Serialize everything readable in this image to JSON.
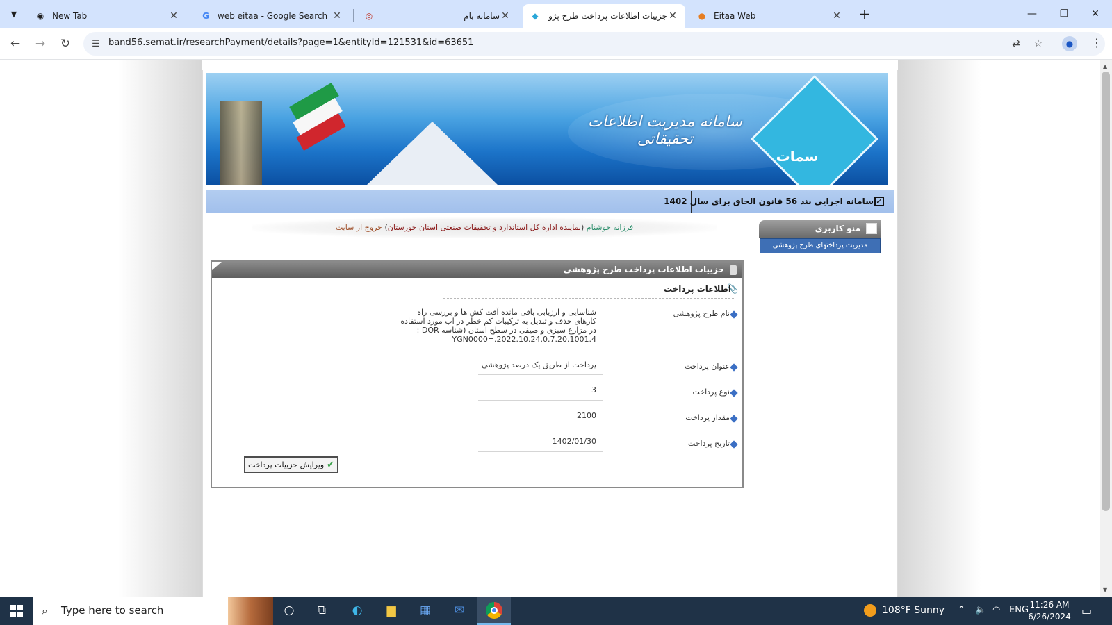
{
  "browser": {
    "tabs": [
      {
        "title": "New Tab",
        "icon": "chrome-icon"
      },
      {
        "title": "web eitaa - Google Search",
        "icon": "google-icon"
      },
      {
        "title": "سامانه بام",
        "icon": "bam-icon"
      },
      {
        "title": "جزییات اطلاعات پرداخت طرح پژو",
        "icon": "semat-icon",
        "active": true
      },
      {
        "title": "Eitaa Web",
        "icon": "eitaa-icon"
      }
    ],
    "url": "band56.semat.ir/researchPayment/details?page=1&entityId=121531&id=63651"
  },
  "page": {
    "banner": {
      "logo_text": "سمات",
      "title_text": "سامانه مدیریت اطلاعات تحقیقاتی"
    },
    "system_title": "سامانه اجرایی بند 56 قانون الحاق برای سال 1402",
    "user": {
      "name": "فرزانه خوشنام",
      "org_open": "(",
      "org": "نماینده اداره کل استاندارد و تحقیقات صنعتی استان خوزستان",
      "org_close": ")",
      "logout": "خروج از سایت"
    },
    "user_menu": {
      "title": "منو کاربری",
      "items": [
        "مدیریت پرداختهای طرح پژوهشی"
      ]
    },
    "panel": {
      "title": "جزییات اطلاعات پرداخت طرح پژوهشی",
      "section_title": "اطلاعات پرداخت",
      "rows": [
        {
          "label": "نام طرح پژوهشی",
          "value_lines": [
            "شناسایی و ارزیابی باقی مانده آفت کش ها و بررسی راه",
            "کارهای حذف و تبدیل به ترکیبات کم خطر در آب مورد استفاده",
            "در مزارع سبزی و صیفی در سطح استان (شناسه DOR :",
            "20.1001.4.YGN0000=.2022.10.24.0.7"
          ]
        },
        {
          "label": "عنوان پرداخت",
          "value": "پرداخت از طریق یک درصد پژوهشی"
        },
        {
          "label": "نوع پرداخت",
          "value": "3"
        },
        {
          "label": "مقدار پرداخت",
          "value": "2100"
        },
        {
          "label": "تاریخ پرداخت",
          "value": "1402/01/30"
        }
      ],
      "edit_button": "ویرایش جزییات پرداخت"
    }
  },
  "taskbar": {
    "search_placeholder": "Type here to search",
    "weather": "108°F  Sunny",
    "language": "ENG",
    "time": "11:26 AM",
    "date": "6/26/2024"
  },
  "colors": {
    "tabstrip": "#d3e3fd",
    "menu_item": "#3e6fb5",
    "system_bar": "#a2c0ec",
    "taskbar": "#1f3247"
  }
}
